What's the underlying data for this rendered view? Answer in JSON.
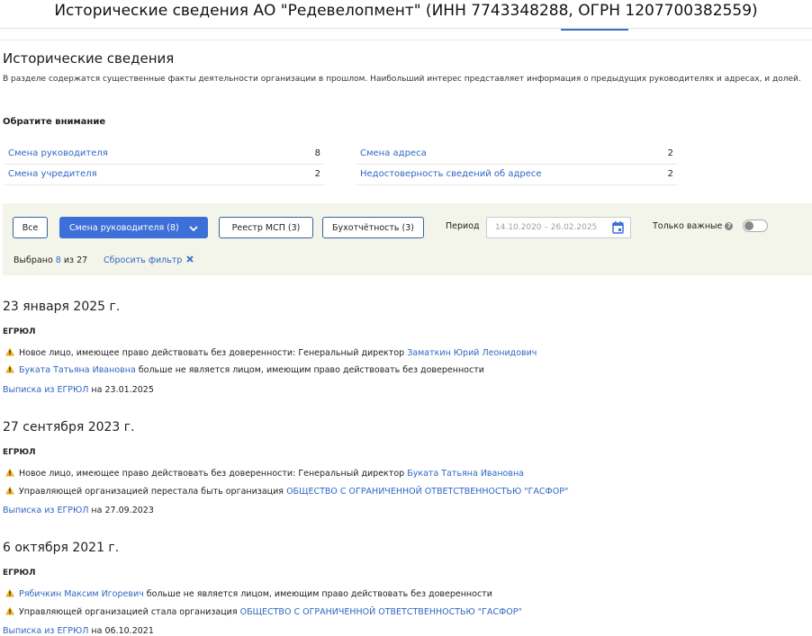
{
  "window_title": "Исторические сведения АО \"Редевелопмент\" (ИНН 7743348288, ОГРН 1207700382559)",
  "section": {
    "title": "Исторические сведения",
    "description": "В разделе содержатся существенные факты деятельности организации в прошлом. Наибольший интерес представляет информация о предыдущих руководителях и адресах, и долей."
  },
  "attention": {
    "title": "Обратите внимание",
    "items": [
      {
        "label": "Смена руководителя",
        "count": "8"
      },
      {
        "label": "Смена учредителя",
        "count": "2"
      },
      {
        "label": "Смена адреса",
        "count": "2"
      },
      {
        "label": "Недостоверность сведений об адресе",
        "count": "2"
      }
    ]
  },
  "filters": {
    "all_label": "Все",
    "director_label": "Смена руководителя (8)",
    "msp_label": "Реестр МСП (3)",
    "accounting_label": "Бухотчётность (3)",
    "period_label": "Период",
    "period_value": "14.10.2020 – 26.02.2025",
    "important_label": "Только важные",
    "important_on": false,
    "selected_prefix": "Выбрано",
    "selected_count": "8",
    "selected_suffix": "из 27",
    "reset_label": "Сбросить фильтр",
    "reset_icon": "close-icon"
  },
  "events": [
    {
      "date": "23 января 2025 г.",
      "source": "ЕГРЮЛ",
      "lines": [
        {
          "text": "Новое лицо, имеющее право действовать без доверенности: Генеральный директор",
          "link": "Заматкин Юрий Леонидович",
          "after": ""
        },
        {
          "text": "",
          "link": "Буката Татьяна Ивановна",
          "after": "больше не является лицом, имеющим право действовать без доверенности"
        }
      ],
      "extract_link": "Выписка из ЕГРЮЛ",
      "extract_date": "на 23.01.2025"
    },
    {
      "date": "27 сентября 2023 г.",
      "source": "ЕГРЮЛ",
      "lines": [
        {
          "text": "Новое лицо, имеющее право действовать без доверенности: Генеральный директор",
          "link": "Буката Татьяна Ивановна",
          "after": ""
        },
        {
          "text": "Управляющей организацией перестала быть организация",
          "link": "ОБЩЕСТВО С ОГРАНИЧЕННОЙ ОТВЕТСТВЕННОСТЬЮ \"ГАСФОР\"",
          "after": ""
        }
      ],
      "extract_link": "Выписка из ЕГРЮЛ",
      "extract_date": "на 27.09.2023"
    },
    {
      "date": "6 октября 2021 г.",
      "source": "ЕГРЮЛ",
      "lines": [
        {
          "text": "",
          "link": "Рябичкин Максим Игоревич",
          "after": "больше не является лицом, имеющим право действовать без доверенности"
        },
        {
          "text": "Управляющей организацией стала организация",
          "link": "ОБЩЕСТВО С ОГРАНИЧЕННОЙ ОТВЕТСТВЕННОСТЬЮ \"ГАСФОР\"",
          "after": ""
        }
      ],
      "extract_link": "Выписка из ЕГРЮЛ",
      "extract_date": "на 06.10.2021"
    }
  ],
  "colors": {
    "accent": "#3d6fd8",
    "link": "#2f67c2",
    "warning": "#f2b01e",
    "filter_bg": "#f4f5ea"
  }
}
